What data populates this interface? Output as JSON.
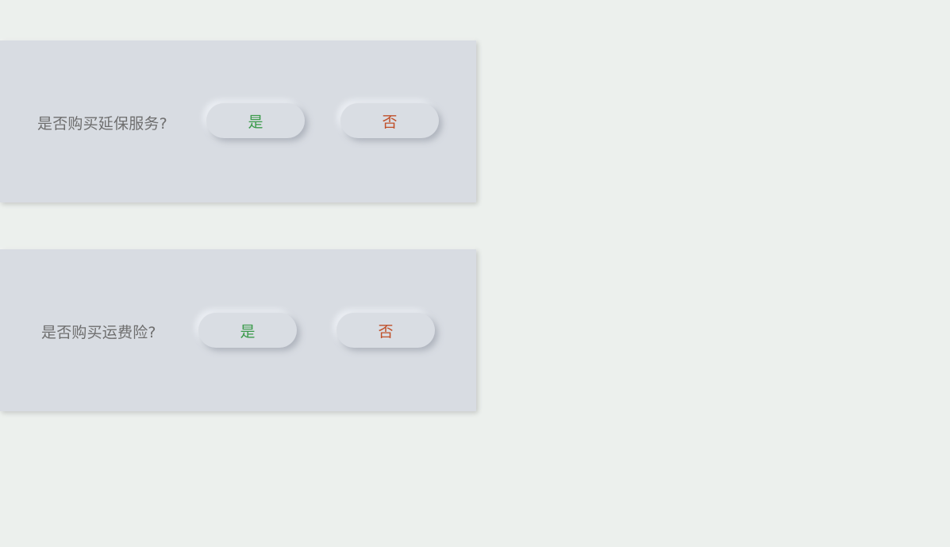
{
  "cards": [
    {
      "question": "是否购买延保服务?",
      "yes_label": "是",
      "no_label": "否"
    },
    {
      "question": "是否购买运费险?",
      "yes_label": "是",
      "no_label": "否"
    }
  ],
  "colors": {
    "background": "#ecf0ed",
    "card": "#d8dce2",
    "yes_text": "#3a9a4a",
    "no_text": "#c0502a",
    "question_text": "#6e6e6e"
  }
}
